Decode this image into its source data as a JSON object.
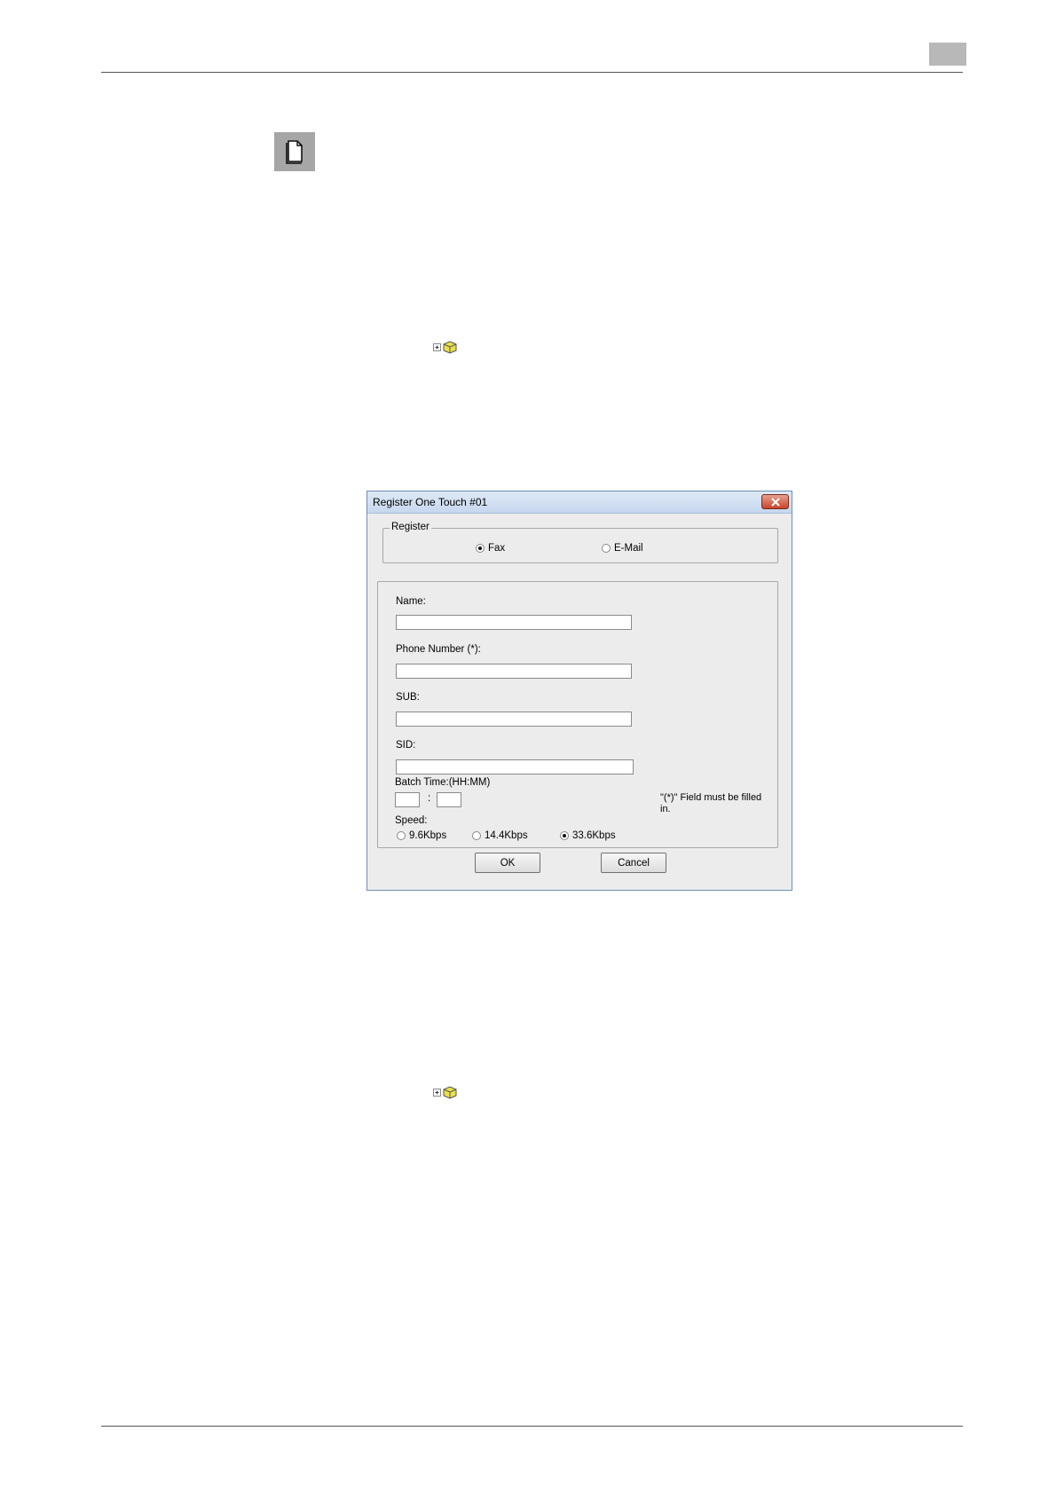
{
  "dialog": {
    "title": "Register One Touch #01",
    "register_group": {
      "legend": "Register",
      "options": [
        {
          "label": "Fax",
          "selected": true
        },
        {
          "label": "E-Mail",
          "selected": false
        }
      ]
    },
    "fields": {
      "name": {
        "label": "Name:",
        "value": ""
      },
      "phone": {
        "label": "Phone Number (*):",
        "value": ""
      },
      "sub": {
        "label": "SUB:",
        "value": ""
      },
      "sid": {
        "label": "SID:",
        "value": ""
      }
    },
    "batch_time": {
      "label": "Batch Time:(HH:MM)",
      "separator": ":",
      "hh": "",
      "mm": ""
    },
    "required_note": "\"(*)\" Field must be filled in.",
    "speed": {
      "label": "Speed:",
      "options": [
        {
          "label": "9.6Kbps",
          "selected": false
        },
        {
          "label": "14.4Kbps",
          "selected": false
        },
        {
          "label": "33.6Kbps",
          "selected": true
        }
      ]
    },
    "buttons": {
      "ok": "OK",
      "cancel": "Cancel"
    }
  },
  "colors": {
    "title_bar": "#c6d7ee",
    "close": "#c8442a",
    "node_icon": "#e9e14a"
  },
  "icons": [
    "note-icon",
    "tree-expand-icon",
    "package-icon",
    "close-icon"
  ]
}
